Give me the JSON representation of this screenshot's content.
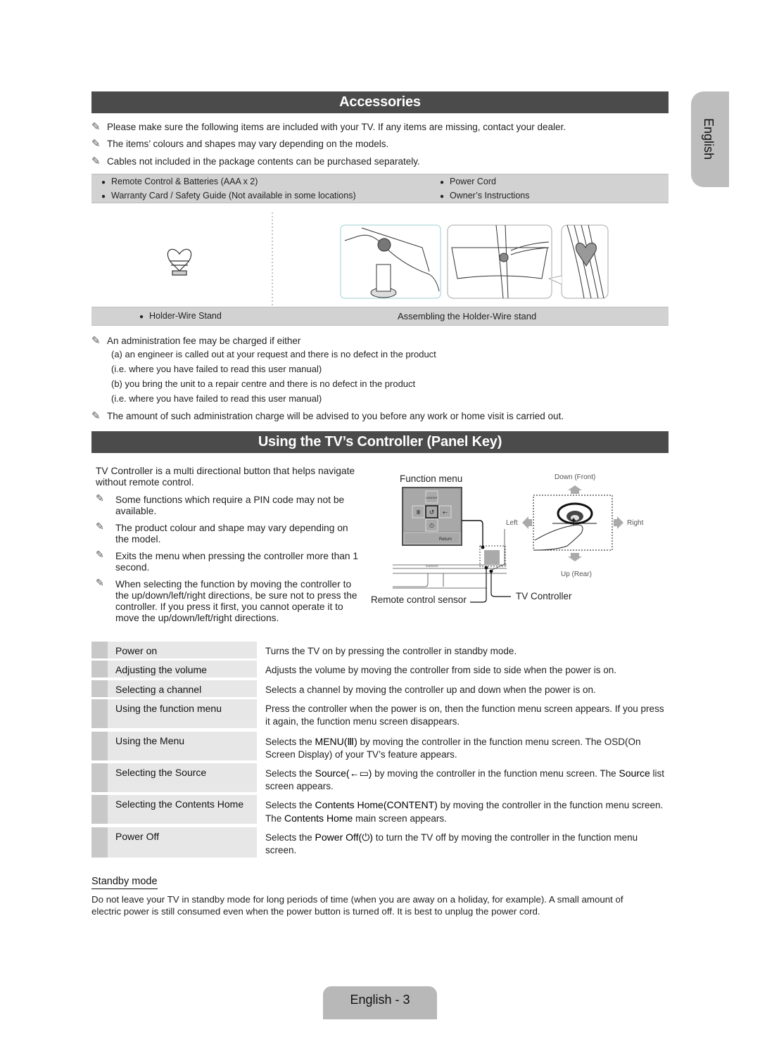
{
  "language_tab": "English",
  "accessories": {
    "title": "Accessories",
    "notes": [
      "Please make sure the following items are included with your TV. If any items are missing, contact your dealer.",
      "The items’ colours and shapes may vary depending on the models.",
      "Cables not included in the package contents can be purchased separately."
    ],
    "items_left": [
      "Remote Control & Batteries (AAA x 2)",
      "Warranty Card / Safety Guide (Not available in some locations)"
    ],
    "items_right": [
      "Power Cord",
      "Owner’s Instructions"
    ],
    "figure_left_caption": "Holder-Wire Stand",
    "figure_right_caption": "Assembling the Holder-Wire stand",
    "admin_fee": {
      "intro": "An administration fee may be charged if either",
      "lines": [
        "(a) an engineer is called out at your request and there is no defect in the product",
        "(i.e. where you have failed to read this user manual)",
        "(b) you bring the unit to a repair centre and there is no defect in the product",
        "(i.e. where you have failed to read this user manual)"
      ],
      "final_note": "The amount of such administration charge will be advised to you before any work or home visit is carried out."
    }
  },
  "controller": {
    "title": "Using the TV’s Controller (Panel Key)",
    "intro": "TV Controller is a multi directional button that helps navigate without remote control.",
    "notes": [
      "Some functions which require a PIN code may not be available.",
      "The product colour and shape may vary depending on the model.",
      "Exits the menu when pressing the controller more than 1 second.",
      "When selecting the function by moving the controller to the up/down/left/right directions, be sure not to press the controller. If you press it first, you cannot operate it to move the up/down/left/right directions."
    ],
    "diagram": {
      "function_menu_label": "Function menu",
      "menu_top_label": "CONTENT",
      "menu_bottom_label": "Return",
      "brand_label": "SAMSUNG",
      "remote_sensor_label": "Remote control sensor",
      "tv_controller_label": "TV Controller",
      "down_label": "Down (Front)",
      "up_label": "Up (Rear)",
      "left_label": "Left",
      "right_label": "Right"
    },
    "rows": [
      {
        "label": "Power on",
        "desc": "Turns the TV on by pressing the controller in standby mode."
      },
      {
        "label": "Adjusting the volume",
        "desc": "Adjusts the volume by moving the controller from side to side when the power is on."
      },
      {
        "label": "Selecting a channel",
        "desc": "Selects a channel by moving the controller up and down when the power is on."
      },
      {
        "label": "Using the function menu",
        "desc": "Press the controller when the power is on, then the function menu screen appears. If you press it again, the function menu screen disappears."
      },
      {
        "label": "Using the Menu",
        "desc_pre": "Selects the ",
        "desc_bold": "MENU(Ⅲ)",
        "desc_post": " by moving the controller in the function menu screen. The OSD(On Screen Display) of your TV’s feature appears."
      },
      {
        "label": "Selecting the Source",
        "desc_pre": "Selects the ",
        "desc_bold": "Source(←▭)",
        "desc_mid": " by moving the controller in the function menu screen. The ",
        "desc_bold2": "Source",
        "desc_post": " list screen appears."
      },
      {
        "label": "Selecting the Contents Home",
        "desc_pre": "Selects the ",
        "desc_bold": "Contents Home(CONTENT)",
        "desc_mid": " by moving the controller in the function menu screen. The ",
        "desc_bold2": "Contents Home",
        "desc_post": " main screen appears."
      },
      {
        "label": "Power Off",
        "desc_pre": "Selects the ",
        "desc_bold": "Power Off(⏻)",
        "desc_post": " to turn the TV off by moving the controller in the function menu screen."
      }
    ]
  },
  "standby": {
    "heading": "Standby mode",
    "text": "Do not leave your TV in standby mode for long periods of time (when you are away on a holiday, for example). A small amount of electric power is still consumed even when the power button is turned off. It is best to unplug the power cord."
  },
  "footer": {
    "page_label": "English - 3"
  }
}
